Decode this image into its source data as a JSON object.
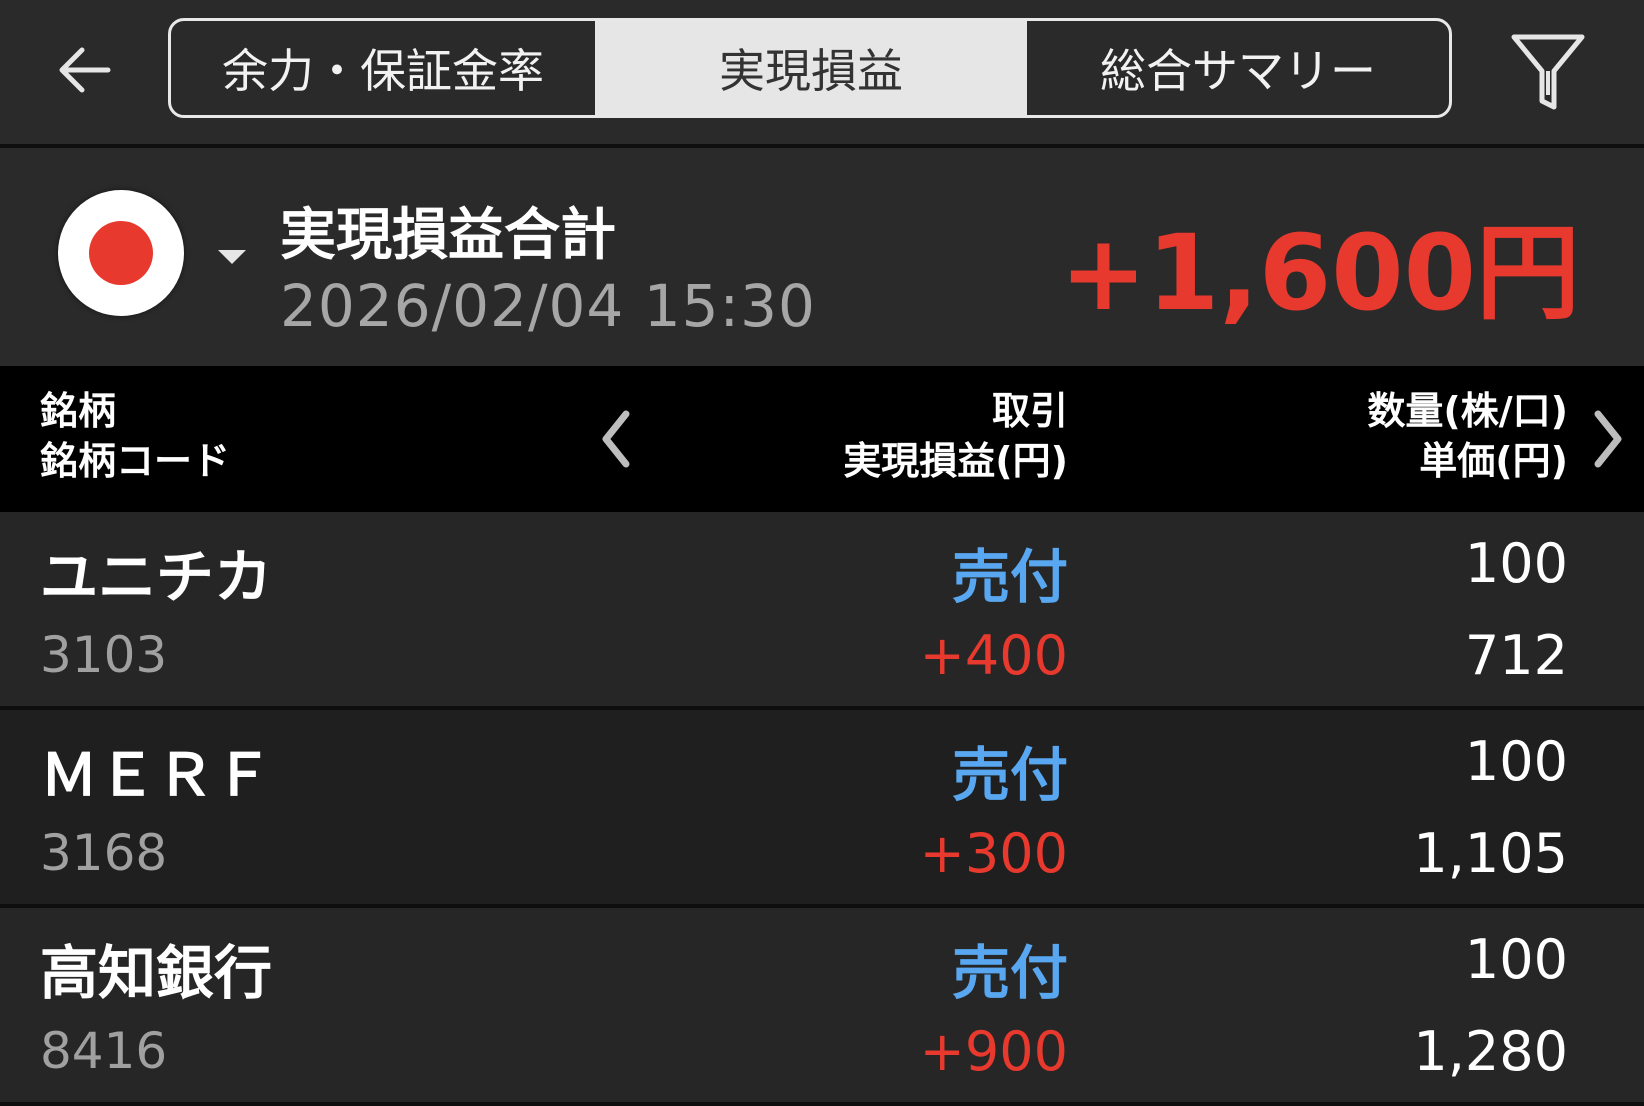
{
  "header": {
    "tabs": [
      {
        "label": "余力・保証金率",
        "active": false
      },
      {
        "label": "実現損益",
        "active": true
      },
      {
        "label": "総合サマリー",
        "active": false
      }
    ],
    "back_icon": "arrow-left-icon",
    "filter_icon": "filter-icon"
  },
  "summary": {
    "market_flag": "japan-flag-icon",
    "title": "実現損益合計",
    "datetime": "2026/02/04  15:30",
    "total": "+1,600円"
  },
  "table": {
    "col1": {
      "line1": "銘柄",
      "line2": "銘柄コード"
    },
    "col2": {
      "line1": "取引",
      "line2": "実現損益(円)"
    },
    "col3": {
      "line1": "数量(株/口)",
      "line2": "単価(円)"
    },
    "rows": [
      {
        "name": "ユニチカ",
        "code": "3103",
        "trade": "売付",
        "pl": "+400",
        "qty": "100",
        "price": "712"
      },
      {
        "name": "ＭＥＲＦ",
        "code": "3168",
        "trade": "売付",
        "pl": "+300",
        "qty": "100",
        "price": "1,105"
      },
      {
        "name": "高知銀行",
        "code": "8416",
        "trade": "売付",
        "pl": "+900",
        "qty": "100",
        "price": "1,280"
      }
    ]
  },
  "colors": {
    "profit": "#e8392e",
    "sell": "#58a7f0",
    "background": "#222222"
  }
}
